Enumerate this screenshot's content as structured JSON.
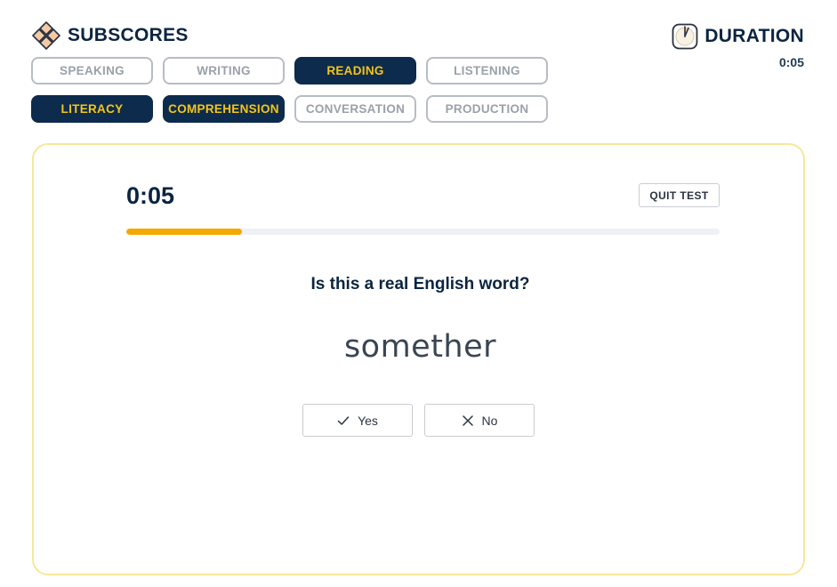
{
  "header": {
    "title": "SUBSCORES",
    "icon": "subscores-diamond-icon"
  },
  "subscores": {
    "row1": [
      {
        "label": "SPEAKING",
        "active": false
      },
      {
        "label": "WRITING",
        "active": false
      },
      {
        "label": "READING",
        "active": true
      },
      {
        "label": "LISTENING",
        "active": false
      }
    ],
    "row2": [
      {
        "label": "LITERACY",
        "active": true
      },
      {
        "label": "COMPREHENSION",
        "active": true
      },
      {
        "label": "CONVERSATION",
        "active": false
      },
      {
        "label": "PRODUCTION",
        "active": false
      }
    ]
  },
  "duration": {
    "title": "DURATION",
    "time": "0:05",
    "icon": "clock-icon"
  },
  "test": {
    "timer": "0:05",
    "quit_label": "QUIT TEST",
    "progress": 0.195,
    "question": "Is this a real English word?",
    "word": "somether",
    "yes_label": "Yes",
    "no_label": "No"
  },
  "colors": {
    "navy": "#0d2b4c",
    "yellow": "#f5c518",
    "progress": "#f5a800",
    "card_border": "#f7e79a"
  }
}
